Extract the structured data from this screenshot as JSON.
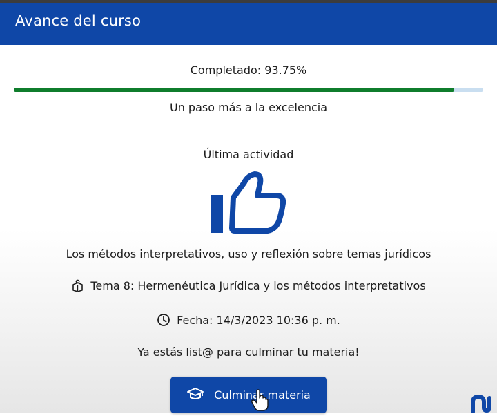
{
  "header": {
    "title": "Avance del curso"
  },
  "progress": {
    "label": "Completado: 93.75%",
    "value": 0.9375,
    "fill_color": "#0f7d2c",
    "track_color": "#c9def0",
    "motto": "Un paso más a la excelencia"
  },
  "last_activity": {
    "heading": "Última actividad",
    "icon": "thumbs-up-icon",
    "course": "Los métodos interpretativos, uso y reflexión sobre temas jurídicos",
    "topic_icon": "book-icon",
    "topic": "Tema 8: Hermenéutica Jurídica y los métodos interpretativos",
    "date_icon": "clock-icon",
    "date": "Fecha: 14/3/2023 10:36 p. m."
  },
  "ready_message": "Ya estás list@ para culminar tu materia!",
  "action": {
    "icon": "graduation-cap-icon",
    "label": "Culminar materia"
  },
  "colors": {
    "brand": "#0f47a7"
  }
}
